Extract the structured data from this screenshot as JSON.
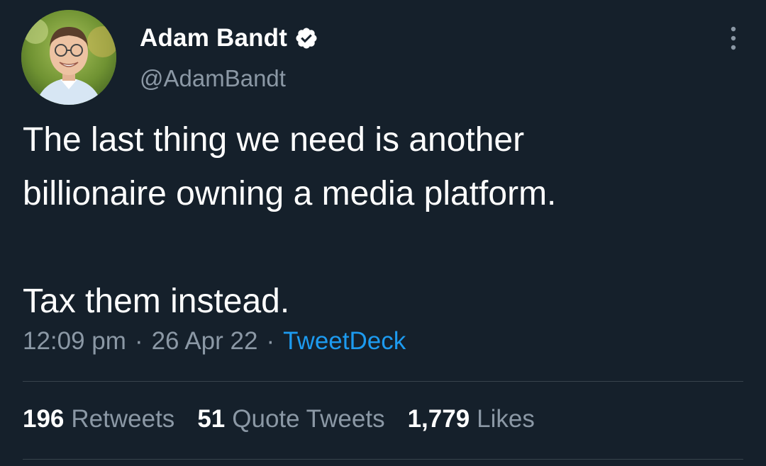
{
  "author": {
    "display_name": "Adam Bandt",
    "handle": "@AdamBandt",
    "verified": true,
    "avatar_icon": "profile-photo"
  },
  "tweet": {
    "text": "The last thing we need is another\nbillionaire owning a media platform.\n\nTax them instead.",
    "time": "12:09 pm",
    "separator": "·",
    "date": "26 Apr 22",
    "source": "TweetDeck"
  },
  "stats": {
    "retweets_count": "196",
    "retweets_label": "Retweets",
    "quote_count": "51",
    "quote_label": "Quote Tweets",
    "likes_count": "1,779",
    "likes_label": "Likes"
  },
  "colors": {
    "background": "#15202b",
    "secondary_text": "#8b98a5",
    "accent": "#1d9bf0",
    "divider": "#38444d"
  }
}
